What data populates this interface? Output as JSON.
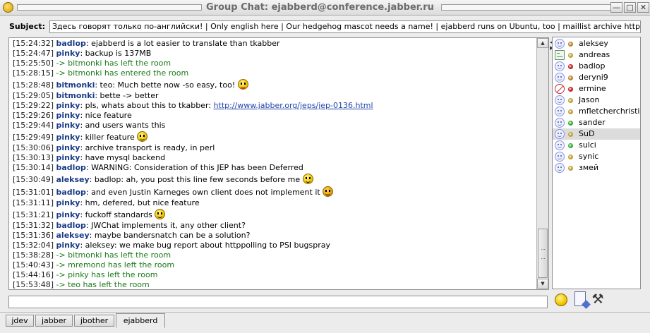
{
  "window": {
    "title": "Group Chat: ejabberd@conference.jabber.ru",
    "minimize_label": "—",
    "maximize_label": "□",
    "close_label": "✕"
  },
  "subject": {
    "label": "Subject:",
    "value": "Здесь говорят только по-английски! | Only english here | Our hedgehog mascot needs a name! | ejabberd runs on Ubuntu, too | maillist archive http://dir.g"
  },
  "chat": {
    "messages": [
      {
        "ts": "[15:24:32]",
        "nick": "badlop",
        "text": ": ejabberd is a lot easier to translate than tkabber"
      },
      {
        "ts": "[15:24:47]",
        "nick": "pinky",
        "text": ": backup is 137MB"
      },
      {
        "ts": "[15:25:50]",
        "sys": " -> bitmonki has left the room"
      },
      {
        "ts": "[15:28:15]",
        "sys": " -> bitmonki has entered the room"
      },
      {
        "ts": "[15:28:48]",
        "nick": "bitmonki",
        "text": ": teo: Much bette now -so easy, too! ",
        "emoticon": "tongue-smiley-icon",
        "tall": true
      },
      {
        "ts": "[15:29:05]",
        "nick": "bitmonki",
        "text": ": bette -> better"
      },
      {
        "ts": "[15:29:22]",
        "nick": "pinky",
        "text": ": pls, whats about this to tkabber: ",
        "link": "http://www.jabber.org/jeps/jep-0136.html"
      },
      {
        "ts": "[15:29:26]",
        "nick": "pinky",
        "text": ": nice feature"
      },
      {
        "ts": "[15:29:44]",
        "nick": "pinky",
        "text": ": and users wants this"
      },
      {
        "ts": "[15:29:49]",
        "nick": "pinky",
        "text": ": killer feature ",
        "emoticon": "wink-smiley-icon",
        "tall": true
      },
      {
        "ts": "[15:30:06]",
        "nick": "pinky",
        "text": ": archive transport is ready, in perl"
      },
      {
        "ts": "[15:30:13]",
        "nick": "pinky",
        "text": ": have mysql backend"
      },
      {
        "ts": "[15:30:14]",
        "nick": "badlop",
        "text": ": WARNING: Consideration of this JEP has been Deferred"
      },
      {
        "ts": "[15:30:49]",
        "nick": "aleksey",
        "text": ": badlop: ah, you post this line few seconds before me ",
        "emoticon": "smiley-icon",
        "tall": true
      },
      {
        "ts": "[15:31:01]",
        "nick": "badlop",
        "text": ": and even Justin Karneges own client does not implement it ",
        "emoticon": "angry-smiley-icon",
        "tall": true
      },
      {
        "ts": "[15:31:11]",
        "nick": "pinky",
        "text": ": hm, defered, but nice feature"
      },
      {
        "ts": "[15:31:21]",
        "nick": "pinky",
        "text": ": fuckoff standards ",
        "emoticon": "wink-smiley-icon",
        "tall": true
      },
      {
        "ts": "[15:31:32]",
        "nick": "badlop",
        "text": ": JWChat implements it, any other client?"
      },
      {
        "ts": "[15:31:36]",
        "nick": "aleksey",
        "text": ": maybe bandersnatch can be a solution?"
      },
      {
        "ts": "[15:32:04]",
        "nick": "pinky",
        "text": ": aleksey: we make bug report about httppolling to PSI bugspray"
      },
      {
        "ts": "[15:38:28]",
        "sys": " -> bitmonki has left the room"
      },
      {
        "ts": "[15:40:43]",
        "sys": " -> mremond has left the room"
      },
      {
        "ts": "[15:44:16]",
        "sys": " -> pinky has left the room"
      },
      {
        "ts": "[15:53:48]",
        "sys": " -> teo has left the room"
      }
    ]
  },
  "roster": {
    "members": [
      {
        "name": "aleksey",
        "icon": "smiley",
        "status_color": "#c08030"
      },
      {
        "name": "andreas",
        "icon": "card",
        "status_color": "#c0a030"
      },
      {
        "name": "badlop",
        "icon": "smiley",
        "status_color": "#c02020"
      },
      {
        "name": "deryni9",
        "icon": "smiley",
        "status_color": "#c08030"
      },
      {
        "name": "ermine",
        "icon": "blocked",
        "status_color": "#c02020"
      },
      {
        "name": "Jason",
        "icon": "smiley",
        "status_color": "#c0a030"
      },
      {
        "name": "mfletcherchristia",
        "icon": "smiley",
        "status_color": "#c0a030"
      },
      {
        "name": "sander",
        "icon": "smiley",
        "status_color": "#30b030"
      },
      {
        "name": "SuD",
        "icon": "smiley",
        "status_color": "#c0a030",
        "selected": true
      },
      {
        "name": "sulci",
        "icon": "smiley",
        "status_color": "#30b030"
      },
      {
        "name": "synic",
        "icon": "smiley",
        "status_color": "#c0a030"
      },
      {
        "name": "змей",
        "icon": "smiley",
        "status_color": "#c0a030"
      }
    ]
  },
  "input": {
    "value": ""
  },
  "tabs": [
    {
      "label": "jdev"
    },
    {
      "label": "jabber"
    },
    {
      "label": "jbother"
    },
    {
      "label": "ejabberd",
      "active": true
    }
  ]
}
